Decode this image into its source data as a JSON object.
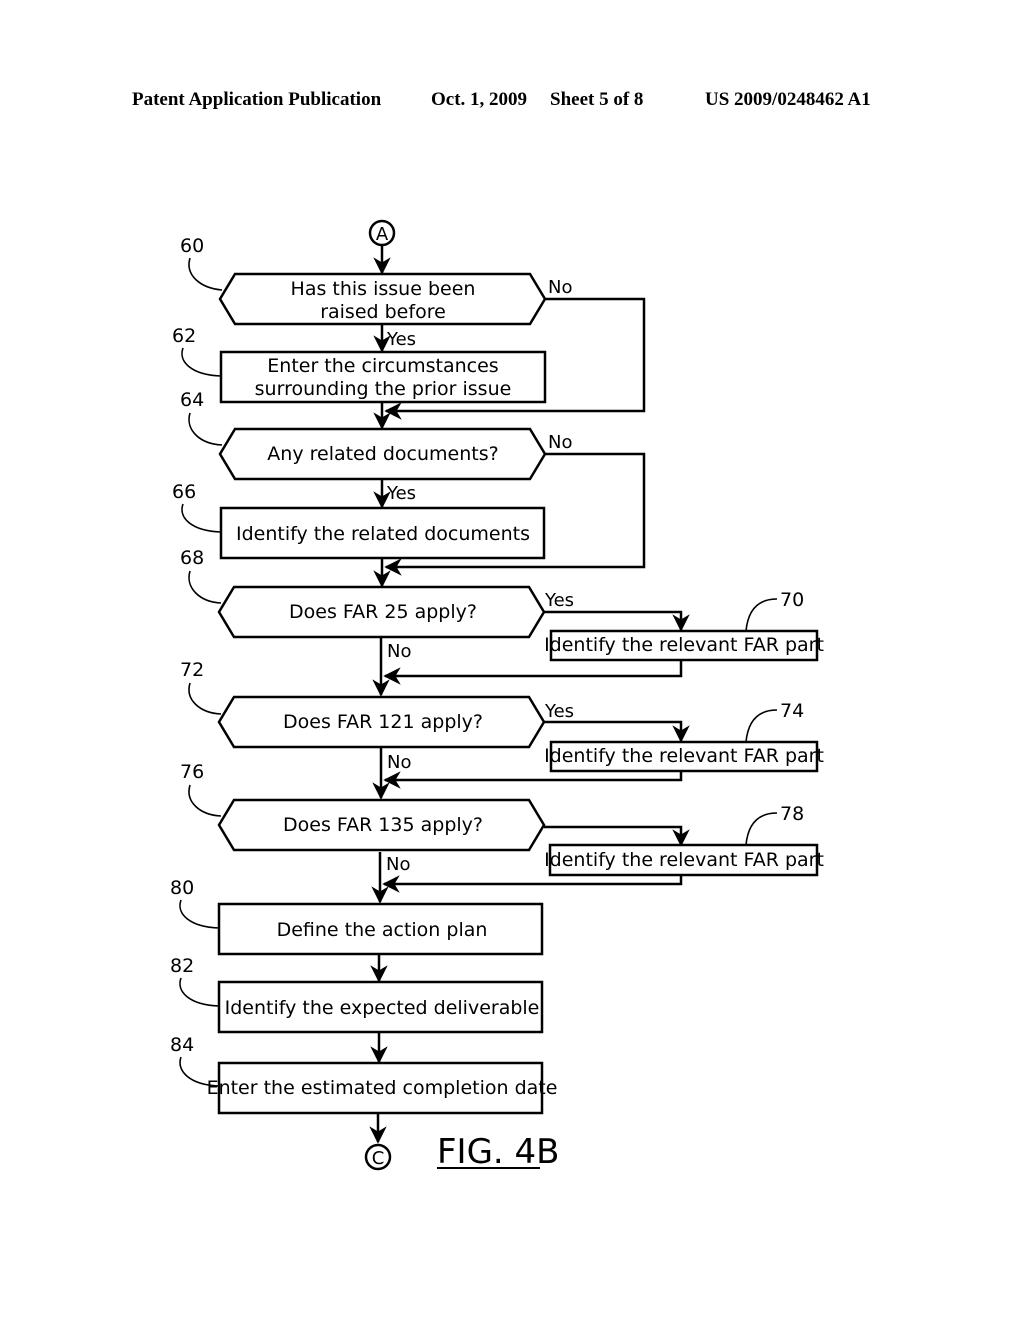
{
  "header": {
    "publication": "Patent Application Publication",
    "date": "Oct. 1, 2009",
    "sheet": "Sheet 5 of 8",
    "number": "US 2009/0248462 A1"
  },
  "connectors": {
    "start": "A",
    "end": "C"
  },
  "figure_label": "FIG. 4B",
  "steps": {
    "s60": {
      "ref": "60",
      "type": "decision",
      "line1": "Has this issue been",
      "line2": "raised before",
      "yes": "Yes",
      "no": "No"
    },
    "s62": {
      "ref": "62",
      "type": "process",
      "line1": "Enter the circumstances",
      "line2": "surrounding the prior issue"
    },
    "s64": {
      "ref": "64",
      "type": "decision",
      "text": "Any related documents?",
      "yes": "Yes",
      "no": "No"
    },
    "s66": {
      "ref": "66",
      "type": "process",
      "text": "Identify the related documents"
    },
    "s68": {
      "ref": "68",
      "type": "decision",
      "text": "Does FAR 25 apply?",
      "yes": "Yes",
      "no": "No"
    },
    "s70": {
      "ref": "70",
      "type": "process",
      "text": "Identify the relevant FAR part"
    },
    "s72": {
      "ref": "72",
      "type": "decision",
      "text": "Does FAR 121 apply?",
      "yes": "Yes",
      "no": "No"
    },
    "s74": {
      "ref": "74",
      "type": "process",
      "text": "Identify the relevant FAR part"
    },
    "s76": {
      "ref": "76",
      "type": "decision",
      "text": "Does FAR 135 apply?",
      "no": "No"
    },
    "s78": {
      "ref": "78",
      "type": "process",
      "text": "Identify the relevant FAR part"
    },
    "s80": {
      "ref": "80",
      "type": "process",
      "text": "Define the action plan"
    },
    "s82": {
      "ref": "82",
      "type": "process",
      "text": "Identify the expected deliverable"
    },
    "s84": {
      "ref": "84",
      "type": "process",
      "text": "Enter the estimated completion date"
    }
  }
}
